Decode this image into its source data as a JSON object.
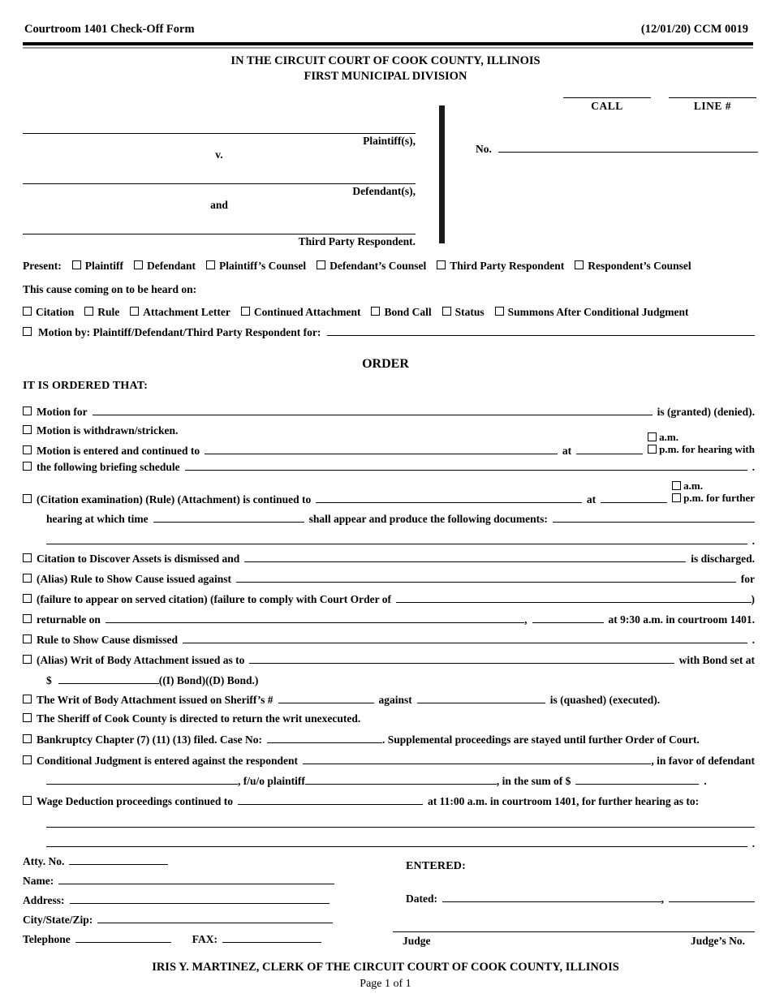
{
  "header": {
    "form_title": "Courtroom 1401 Check-Off Form",
    "revision_code": "(12/01/20) CCM 0019"
  },
  "court": {
    "line1": "IN THE CIRCUIT COURT OF COOK COUNTY, ILLINOIS",
    "line2": "FIRST MUNICIPAL DIVISION"
  },
  "caption": {
    "call_label": "CALL",
    "line_label": "LINE #",
    "plaintiff_role": "Plaintiff(s),",
    "versus": "v.",
    "defendant_role": "Defendant(s),",
    "and": "and",
    "third_party_role": "Third Party Respondent.",
    "number_label": "No."
  },
  "present": {
    "label": "Present:",
    "options": [
      "Plaintiff",
      "Defendant",
      "Plaintiff’s Counsel",
      "Defendant’s Counsel",
      "Third Party Respondent",
      "Respondent’s Counsel"
    ]
  },
  "cause": {
    "heading": "This cause coming on to be heard on:",
    "options": [
      "Citation",
      "Rule",
      "Attachment Letter",
      "Continued Attachment",
      "Bond Call",
      "Status",
      "Summons After Conditional Judgment"
    ],
    "motion_by": "Motion by:  Plaintiff/Defendant/Third Party Respondent for:"
  },
  "order": {
    "title": "ORDER",
    "ordered_that": "IT IS ORDERED THAT:",
    "motion_for": "Motion for",
    "is_granted_denied": "is (granted) (denied).",
    "withdrawn": "Motion is withdrawn/stricken.",
    "entered_continued": "Motion is entered and continued to",
    "at": "at",
    "am": "a.m.",
    "pm_hearing_with": "p.m. for hearing with",
    "briefing_schedule": "the following briefing schedule",
    "period": ".",
    "citation_exam": "(Citation examination) (Rule) (Attachment) is continued to",
    "pm_further": "p.m. for further",
    "hearing_at_which_time": "hearing at which time",
    "shall_appear": "shall appear and produce the following documents:",
    "citation_dismissed": "Citation to Discover Assets is dismissed and",
    "is_discharged": "is discharged.",
    "alias_rule": "(Alias) Rule to Show Cause issued against",
    "for": "for",
    "failure_to_appear": "(failure to appear on served citation) (failure to comply with Court Order of",
    "close_paren": ")",
    "returnable_on": "returnable on",
    "comma": ",",
    "at_930": "at 9:30 a.m. in courtroom 1401.",
    "rule_dismissed": "Rule to Show Cause dismissed",
    "alias_writ": "(Alias) Writ of Body Attachment issued as to",
    "with_bond_set_at": "with Bond set at",
    "dollar": "$",
    "bond_types": "((I) Bond)((D) Bond.)",
    "writ_issued_sheriff": "The Writ of Body Attachment issued on Sheriff’s #",
    "against": "against",
    "is_quashed_executed": "is (quashed) (executed).",
    "sheriff_return": "The Sheriff of Cook County is directed to return the writ unexecuted.",
    "bankruptcy": "Bankruptcy Chapter (7) (11) (13) filed.  Case No:",
    "bankruptcy_tail": ".  Supplemental proceedings are stayed until further Order of Court.",
    "conditional_judgment": "Conditional Judgment is entered against the respondent",
    "in_favor_of_defendant": ", in favor of defendant",
    "fuo_plaintiff": ", f/u/o plaintiff",
    "in_the_sum_of": ", in the sum of $",
    "wage_deduction": "Wage Deduction proceedings continued to",
    "wage_tail": "at 11:00 a.m. in courtroom 1401, for further hearing as to:"
  },
  "attorney": {
    "atty_no": "Atty. No.",
    "name": "Name:",
    "address": "Address:",
    "city_state_zip": "City/State/Zip:",
    "telephone": "Telephone",
    "fax": "FAX:"
  },
  "entered": {
    "label": "ENTERED:",
    "dated_label": "Dated:",
    "comma": ",",
    "judge_label": "Judge",
    "judge_no_label": "Judge’s No."
  },
  "footer": {
    "clerk": "IRIS Y. MARTINEZ, CLERK OF THE CIRCUIT COURT OF COOK COUNTY, ILLINOIS",
    "page": "Page 1 of 1"
  }
}
